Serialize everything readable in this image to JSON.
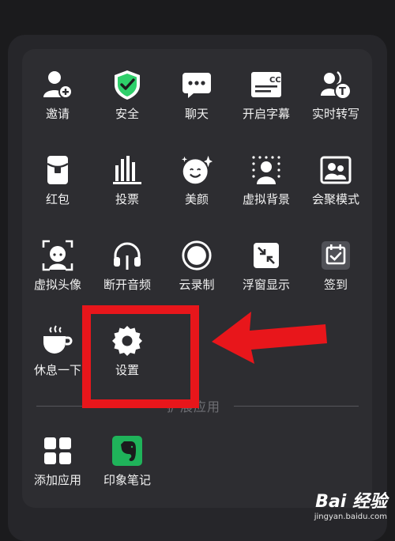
{
  "menu": {
    "items": [
      {
        "label": "邀请",
        "icon": "invite-user-icon"
      },
      {
        "label": "安全",
        "icon": "security-shield-icon"
      },
      {
        "label": "聊天",
        "icon": "chat-bubble-icon"
      },
      {
        "label": "开启字幕",
        "icon": "captions-cc-icon"
      },
      {
        "label": "实时转写",
        "icon": "live-transcribe-icon"
      },
      {
        "label": "红包",
        "icon": "red-packet-icon"
      },
      {
        "label": "投票",
        "icon": "vote-bars-icon"
      },
      {
        "label": "美颜",
        "icon": "beauty-face-icon"
      },
      {
        "label": "虚拟背景",
        "icon": "virtual-background-icon"
      },
      {
        "label": "会聚模式",
        "icon": "together-mode-icon"
      },
      {
        "label": "虚拟头像",
        "icon": "virtual-avatar-icon"
      },
      {
        "label": "断开音频",
        "icon": "headphones-icon"
      },
      {
        "label": "云录制",
        "icon": "cloud-record-icon"
      },
      {
        "label": "浮窗显示",
        "icon": "float-window-icon"
      },
      {
        "label": "签到",
        "icon": "check-in-icon"
      },
      {
        "label": "休息一下",
        "icon": "coffee-cup-icon"
      },
      {
        "label": "设置",
        "icon": "settings-gear-icon"
      }
    ],
    "section_label": "扩展应用",
    "apps": [
      {
        "label": "添加应用",
        "icon": "add-app-grid-icon"
      },
      {
        "label": "印象笔记",
        "icon": "evernote-elephant-icon"
      }
    ]
  },
  "watermark": {
    "main": "Bai 经验",
    "sub": "jingyan.baidu.com"
  },
  "colors": {
    "annotation": "#e8161b",
    "panel": "#2d2d31",
    "shield": "#2ecf6a",
    "evernote": "#1fb35a"
  }
}
